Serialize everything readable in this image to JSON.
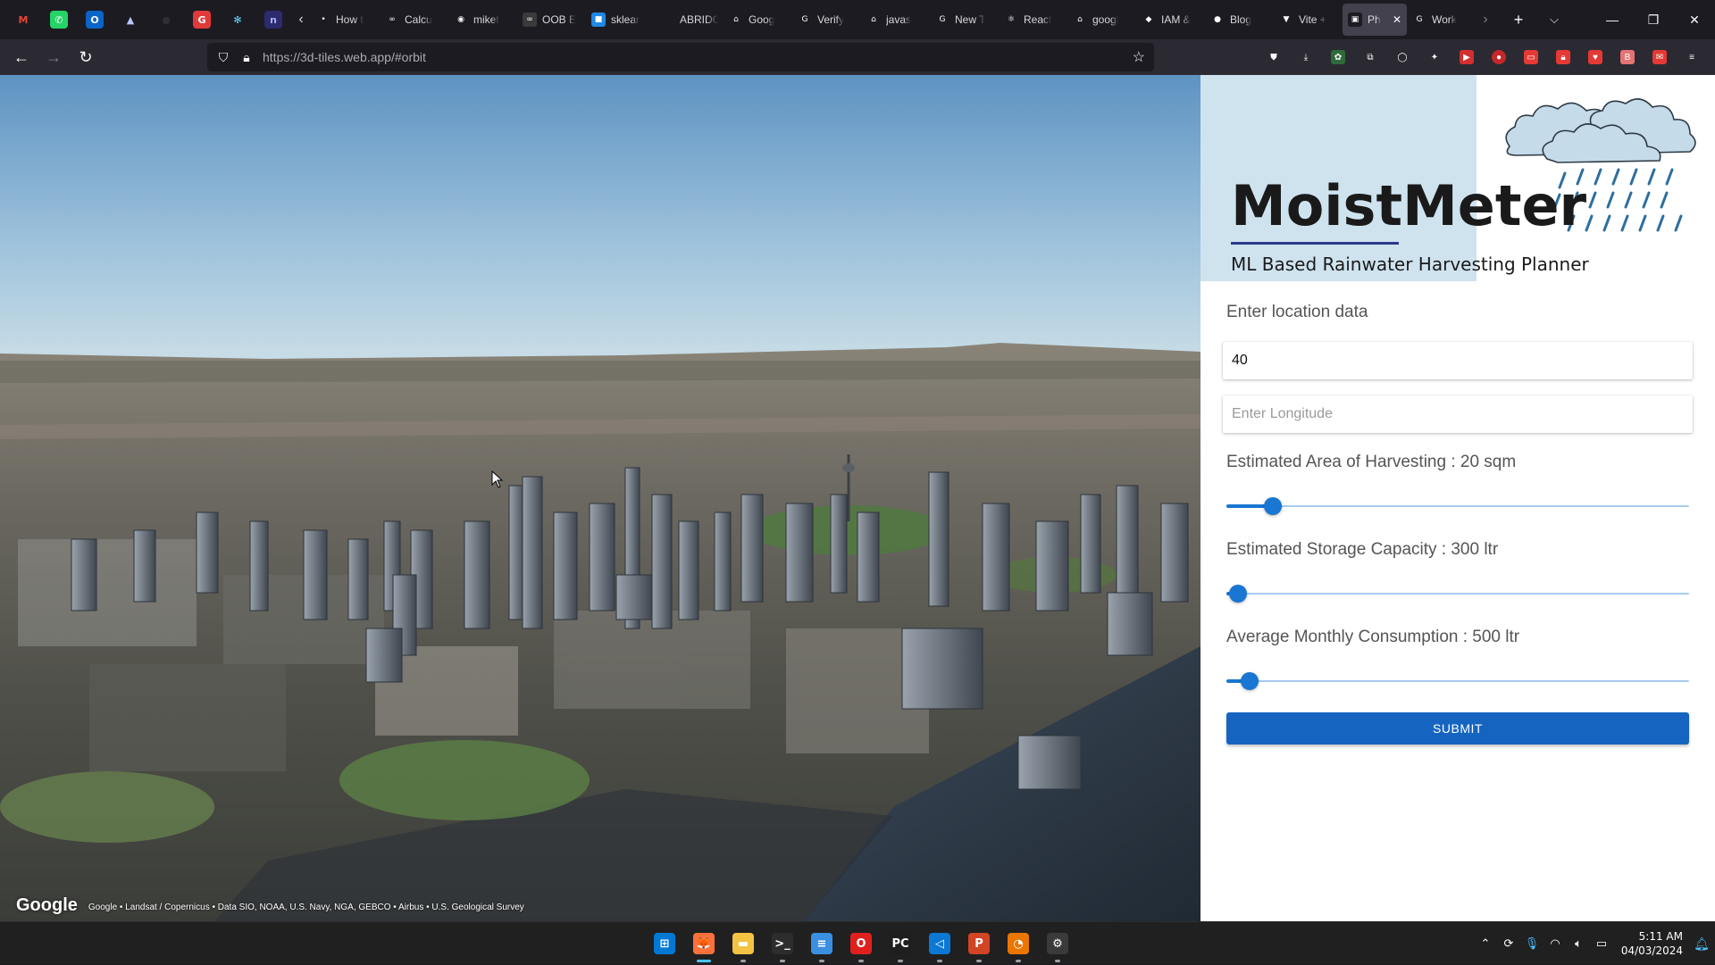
{
  "browser": {
    "pinned_tabs": [
      {
        "name": "gmail-pinned-tab",
        "glyph": "M",
        "color": "#1c1b22",
        "fg": "#ea4335"
      },
      {
        "name": "whatsapp-pinned-tab",
        "glyph": "✆",
        "color": "#25d366",
        "fg": "#ffffff"
      },
      {
        "name": "outlook-pinned-tab",
        "glyph": "O",
        "color": "#0a64c9",
        "fg": "#ffffff"
      },
      {
        "name": "copilot-pinned-tab",
        "glyph": "▲",
        "color": "#1c1b22",
        "fg": "#b9c7ff"
      },
      {
        "name": "dark-pinned-tab",
        "glyph": "●",
        "color": "#1c1b22",
        "fg": "#2e2e35"
      },
      {
        "name": "chrome-pinned-tab",
        "glyph": "G",
        "color": "#e03a3a",
        "fg": "#ffffff"
      },
      {
        "name": "react-pinned-tab",
        "glyph": "✻",
        "color": "#1c1b22",
        "fg": "#61dafb"
      },
      {
        "name": "notion-pinned-tab",
        "glyph": "n",
        "color": "#2d2a6e",
        "fg": "#aab0ff"
      }
    ],
    "tabs": [
      {
        "title": "How t",
        "fav": "•",
        "color": "#1c1b22"
      },
      {
        "title": "Calcu",
        "fav": "∞",
        "color": "#1c1b22"
      },
      {
        "title": "miket",
        "fav": "◉",
        "color": "#1c1b22"
      },
      {
        "title": "OOB E",
        "fav": "∞",
        "color": "#3a3a3a"
      },
      {
        "title": "sklear",
        "fav": "■",
        "color": "#1e88e5"
      },
      {
        "title": "ABRIDGED",
        "fav": "",
        "color": "#1c1b22"
      },
      {
        "title": "Goog",
        "fav": "⌂",
        "color": "#1c1b22"
      },
      {
        "title": "Verify",
        "fav": "G",
        "color": "#1c1b22"
      },
      {
        "title": "javas",
        "fav": "⌂",
        "color": "#1c1b22"
      },
      {
        "title": "New T",
        "fav": "G",
        "color": "#1c1b22"
      },
      {
        "title": "React",
        "fav": "⚛",
        "color": "#1c1b22"
      },
      {
        "title": "googl",
        "fav": "⌂",
        "color": "#1c1b22"
      },
      {
        "title": "IAM &",
        "fav": "◆",
        "color": "#1c1b22"
      },
      {
        "title": "Blog",
        "fav": "●",
        "color": "#1c1b22"
      },
      {
        "title": "Vite +",
        "fav": "▼",
        "color": "#1c1b22"
      },
      {
        "title": "Ph",
        "fav": "▣",
        "color": "#1c1b22",
        "active": true
      },
      {
        "title": "Work",
        "fav": "G",
        "color": "#1c1b22"
      }
    ],
    "url_host": "https://3d-tiles.web.app/",
    "url_path": "#orbit"
  },
  "map": {
    "logo": "Google",
    "attribution": "Google • Landsat / Copernicus • Data SIO, NOAA, U.S. Navy, NGA, GEBCO • Airbus • U.S. Geological Survey"
  },
  "app": {
    "brand": "MoistMeter",
    "subtitle": "ML Based Rainwater Harvesting Planner",
    "location_label": "Enter location data",
    "latitude_value": "40",
    "longitude_placeholder": "Enter Longitude",
    "area_label": "Estimated Area of Harvesting : 20 sqm",
    "storage_label": "Estimated Storage Capacity : 300 ltr",
    "consumption_label": "Average Monthly Consumption : 500 ltr",
    "sliders": {
      "area": 0.1,
      "storage": 0.026,
      "consumption": 0.05
    },
    "submit_label": "SUBMIT",
    "accent": "#1976d2"
  },
  "taskbar": {
    "apps": [
      {
        "name": "start-button",
        "glyph": "⊞",
        "color": "#0078d4",
        "active": false,
        "dot": false
      },
      {
        "name": "firefox-app",
        "glyph": "🦊",
        "color": "#ff7139",
        "active": true,
        "dot": true
      },
      {
        "name": "file-explorer-app",
        "glyph": "▬",
        "color": "#f3c343",
        "active": false,
        "dot": true
      },
      {
        "name": "terminal-app",
        "glyph": ">_",
        "color": "#2d2d2d",
        "active": false,
        "dot": true
      },
      {
        "name": "notepad-app",
        "glyph": "≡",
        "color": "#3b8fe0",
        "active": false,
        "dot": true
      },
      {
        "name": "opera-app",
        "glyph": "O",
        "color": "#e0201e",
        "active": false,
        "dot": true
      },
      {
        "name": "pycharm-app",
        "glyph": "PC",
        "color": "#1e1e1e",
        "active": false,
        "dot": true
      },
      {
        "name": "vscode-app",
        "glyph": "◁",
        "color": "#0a78d4",
        "active": false,
        "dot": true
      },
      {
        "name": "powerpoint-app",
        "glyph": "P",
        "color": "#d14424",
        "active": false,
        "dot": true
      },
      {
        "name": "blender-app",
        "glyph": "◔",
        "color": "#ea7600",
        "active": false,
        "dot": true
      },
      {
        "name": "settings-app",
        "glyph": "⚙",
        "color": "#3a3a3a",
        "active": false,
        "dot": true
      }
    ],
    "time": "5:11 AM",
    "date": "04/03/2024"
  }
}
